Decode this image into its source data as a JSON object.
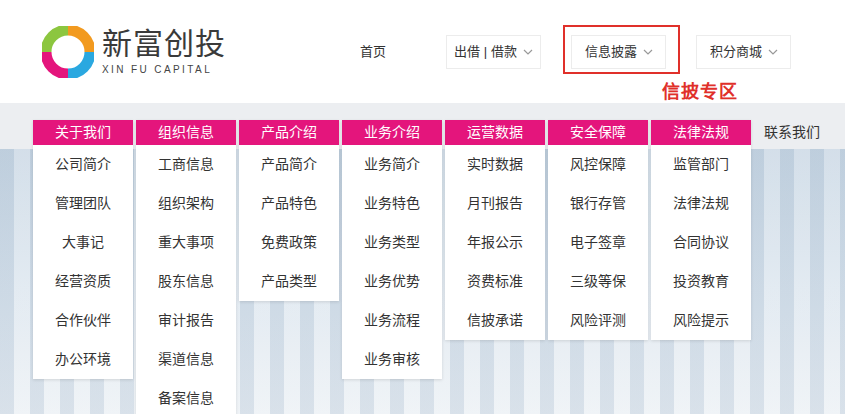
{
  "logo": {
    "name": "新富创投",
    "subtitle": "XIN FU CAPITAL"
  },
  "nav": [
    {
      "label": "首页",
      "dropdown": false,
      "highlighted": false
    },
    {
      "label": "出借 | 借款",
      "dropdown": true,
      "highlighted": false
    },
    {
      "label": "信息披露",
      "dropdown": true,
      "highlighted": true
    },
    {
      "label": "积分商城",
      "dropdown": true,
      "highlighted": false
    }
  ],
  "annotation": {
    "label": "信披专区"
  },
  "menu": {
    "columns": [
      {
        "title": "关于我们",
        "items": [
          "公司简介",
          "管理团队",
          "大事记",
          "经营资质",
          "合作伙伴",
          "办公环境"
        ]
      },
      {
        "title": "组织信息",
        "items": [
          "工商信息",
          "组织架构",
          "重大事项",
          "股东信息",
          "审计报告",
          "渠道信息",
          "备案信息"
        ]
      },
      {
        "title": "产品介绍",
        "items": [
          "产品简介",
          "产品特色",
          "免费政策",
          "产品类型"
        ]
      },
      {
        "title": "业务介绍",
        "items": [
          "业务简介",
          "业务特色",
          "业务类型",
          "业务优势",
          "业务流程",
          "业务审核"
        ]
      },
      {
        "title": "运营数据",
        "items": [
          "实时数据",
          "月刊报告",
          "年报公示",
          "资费标准",
          "信披承诺"
        ]
      },
      {
        "title": "安全保障",
        "items": [
          "风控保障",
          "银行存管",
          "电子签章",
          "三级等保",
          "风险评测"
        ]
      },
      {
        "title": "法律法规",
        "items": [
          "监管部门",
          "法律法规",
          "合同协议",
          "投资教育",
          "风险提示"
        ]
      }
    ],
    "extra": "联系我们"
  }
}
